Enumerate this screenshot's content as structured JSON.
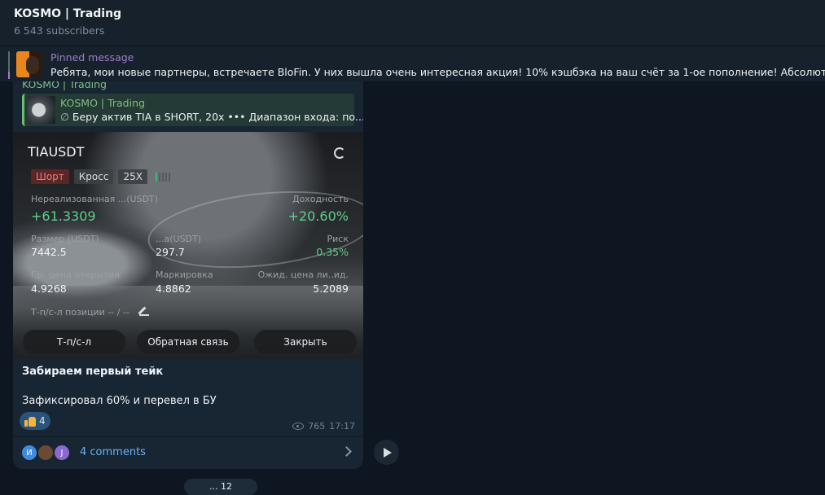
{
  "header": {
    "title": "KOSMO | Trading",
    "subscribers": "6 543 subscribers"
  },
  "pinned": {
    "label": "Pinned message",
    "text": "Ребята, мои новые партнеры, встречаете BloFin.  У них вышла очень интересная акция!  10% кэшбэка на ваш счёт за 1-ое пополнение!  Абсолютно кажд"
  },
  "post": {
    "author": "KOSMO | Trading",
    "reply": {
      "title": "KOSMO | Trading",
      "icon_text": "∅",
      "text": "Беру актив TIA в SHORT, 20x  ••• Диапазон входа: по..."
    },
    "card": {
      "symbol": "TIAUSDT",
      "tags": [
        "Шорт",
        "Кросс",
        "25X"
      ],
      "unrealized_label": "Нереализованная ...(USDT)",
      "unrealized_value": "+61.3309",
      "yield_label": "Доходность",
      "yield_value": "+20.60%",
      "size_label": "Размер (USDT)",
      "size_value": "7442.5",
      "margin_label": "...а(USDT)",
      "margin_value": "297.7",
      "risk_label": "Риск",
      "risk_value": "0.35%",
      "open_label": "Ср. цена открытия",
      "open_value": "4.9268",
      "mark_label": "Маркировка",
      "mark_value": "4.8862",
      "liq_label": "Ожид. цена ли..ид.",
      "liq_value": "5.2089",
      "tpsl_label": "Т-п/с-л позиции  -- / --",
      "buttons": [
        "Т-п/с-л",
        "Обратная связь",
        "Закрыть"
      ]
    },
    "caption_title": "Забираем первый тейк",
    "caption_body": "Зафиксировал 60% и перевел в БУ",
    "reaction": {
      "emoji": "thumbs-up-icon",
      "count": "4"
    },
    "views": "765",
    "time": "17:17",
    "comments": {
      "avatars": [
        "И",
        "",
        "J"
      ],
      "label": "4 comments"
    }
  },
  "date_pill": "... 12",
  "colors": {
    "bg": "#0e1621",
    "header": "#17212b",
    "bubble": "#182533",
    "accent": "#6ab3f3",
    "green": "#5fd08f",
    "purple": "#9a7ec9"
  }
}
